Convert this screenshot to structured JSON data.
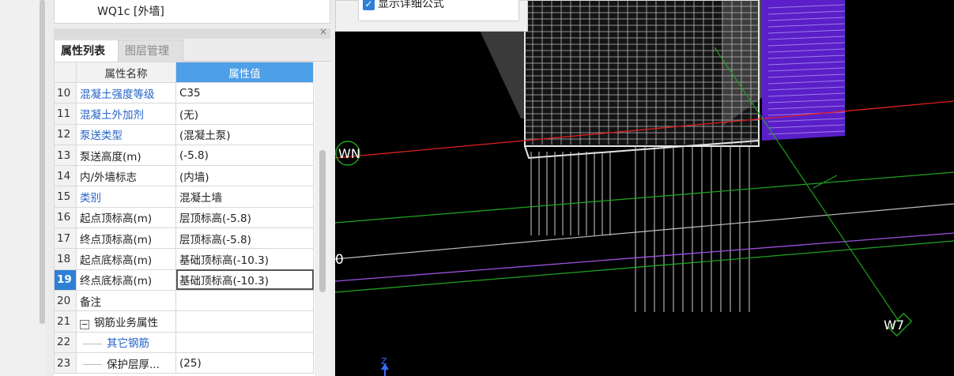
{
  "top_list": {
    "item": "WQ1c [外墙]"
  },
  "panel": {
    "close_label": "×",
    "tabs": [
      {
        "label": "属性列表"
      },
      {
        "label": "图层管理"
      }
    ]
  },
  "grid": {
    "headers": {
      "name": "属性名称",
      "value": "属性值"
    },
    "rows": [
      {
        "num": "10",
        "name": "混凝土强度等级",
        "value": "C35"
      },
      {
        "num": "11",
        "name": "混凝土外加剂",
        "value": "(无)"
      },
      {
        "num": "12",
        "name": "泵送类型",
        "value": "(混凝土泵)"
      },
      {
        "num": "13",
        "name": "泵送高度(m)",
        "value": "(-5.8)"
      },
      {
        "num": "14",
        "name": "内/外墙标志",
        "value": "(内墙)"
      },
      {
        "num": "15",
        "name": "类别",
        "value": "混凝土墙"
      },
      {
        "num": "16",
        "name": "起点顶标高(m)",
        "value": "层顶标高(-5.8)"
      },
      {
        "num": "17",
        "name": "终点顶标高(m)",
        "value": "层顶标高(-5.8)"
      },
      {
        "num": "18",
        "name": "起点底标高(m)",
        "value": "基础顶标高(-10.3)"
      },
      {
        "num": "19",
        "name": "终点底标高(m)",
        "value": "基础顶标高(-10.3)"
      },
      {
        "num": "20",
        "name": "备注",
        "value": ""
      },
      {
        "num": "21",
        "name": "钢筋业务属性",
        "value": "",
        "expander": "−"
      },
      {
        "num": "22",
        "name": "其它钢筋",
        "value": ""
      },
      {
        "num": "23",
        "name": "保护层厚...",
        "value": "(25)"
      }
    ]
  },
  "viewport": {
    "checkbox_label": "显示详细公式",
    "axis_labels": {
      "wn": "WN",
      "w7": "W7",
      "zero": "0",
      "z": "Z"
    }
  },
  "colors": {
    "selected_row": "#2e7fd6",
    "header_value_bg": "#4d9fe8",
    "link_blue": "#2463c8",
    "wall_purple": "#5a1fc8",
    "axis_red": "#e02020",
    "axis_green": "#1fa01f",
    "axis_purple": "#a050e0"
  }
}
